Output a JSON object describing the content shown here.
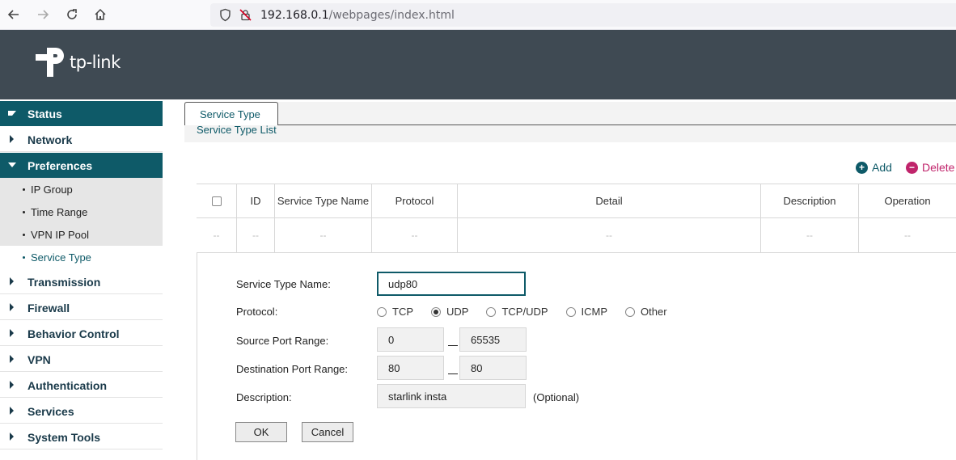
{
  "browser": {
    "url_host": "192.168.0.1",
    "url_path": "/webpages/index.html"
  },
  "header": {
    "logo_text": "tp-link",
    "logo_icon": "tp-link-logo-icon"
  },
  "sidebar": {
    "items": [
      {
        "label": "Status"
      },
      {
        "label": "Network"
      },
      {
        "label": "Preferences"
      },
      {
        "label": "Transmission"
      },
      {
        "label": "Firewall"
      },
      {
        "label": "Behavior Control"
      },
      {
        "label": "VPN"
      },
      {
        "label": "Authentication"
      },
      {
        "label": "Services"
      },
      {
        "label": "System Tools"
      }
    ],
    "subitems": [
      {
        "label": "IP Group"
      },
      {
        "label": "Time Range"
      },
      {
        "label": "VPN IP Pool"
      },
      {
        "label": "Service Type"
      }
    ],
    "active_item": "Preferences",
    "selected_subitem": "Service Type"
  },
  "tabs": {
    "active_tab": "Service Type",
    "section_title": "Service Type List"
  },
  "actions": {
    "add_label": "Add",
    "delete_label": "Delete"
  },
  "table": {
    "columns": [
      "ID",
      "Service Type Name",
      "Protocol",
      "Detail",
      "Description",
      "Operation"
    ],
    "rows": [
      [
        "--",
        "--",
        "--",
        "--",
        "--",
        "--",
        "--"
      ]
    ]
  },
  "form": {
    "name_label": "Service Type Name:",
    "name_value": "udp80",
    "protocol_label": "Protocol:",
    "protocol_options": [
      "TCP",
      "UDP",
      "TCP/UDP",
      "ICMP",
      "Other"
    ],
    "protocol_selected": "UDP",
    "source_label": "Source Port Range:",
    "source_from": "0",
    "source_to": "65535",
    "dest_label": "Destination Port Range:",
    "dest_from": "80",
    "dest_to": "80",
    "description_label": "Description:",
    "description_value": "starlink insta",
    "optional_hint": "(Optional)",
    "ok_label": "OK",
    "cancel_label": "Cancel"
  },
  "colors": {
    "accent": "#0e5a68",
    "header_bg": "#3f4a53",
    "add_icon": "#0e5a68",
    "delete_icon": "#c0246b"
  }
}
